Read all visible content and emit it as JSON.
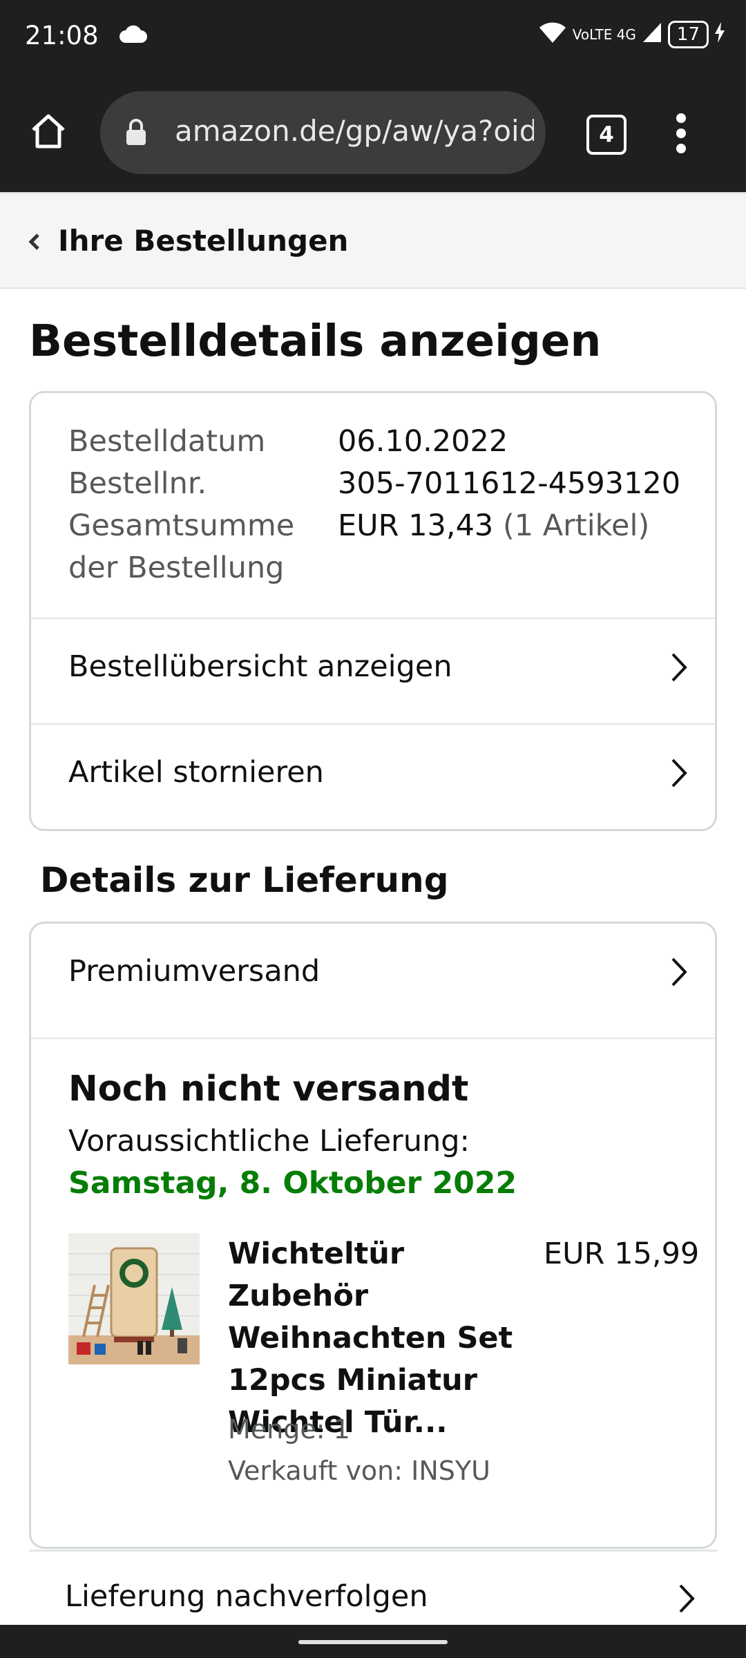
{
  "status_bar": {
    "time": "21:08",
    "network": "VoLTE 4G",
    "battery": "17"
  },
  "browser": {
    "url": "amazon.de/gp/aw/ya?oid=",
    "tab_count": "4"
  },
  "breadcrumb": {
    "back_label": "Ihre Bestellungen"
  },
  "page": {
    "title": "Bestelldetails anzeigen"
  },
  "order": {
    "date_label": "Bestelldatum",
    "date": "06.10.2022",
    "number_label": "Bestellnr.",
    "number": "305-7011612-4593120",
    "total_label_1": "Gesamtsumme",
    "total_label_2": "der Bestellung",
    "total": "EUR 13,43",
    "item_count": "(1 Artikel)",
    "actions": [
      "Bestellübersicht anzeigen",
      "Artikel stornieren"
    ]
  },
  "delivery": {
    "section_title": "Details zur Lieferung",
    "shipping_method": "Premiumversand",
    "status": "Noch nicht versandt",
    "eta_label": "Voraussichtliche Lieferung:",
    "eta_date": "Samstag, 8. Oktober 2022",
    "item": {
      "title": "Wichteltür Zubehör Weihnachten Set 12pcs Miniatur Wichtel Tür...",
      "price": "EUR 15,99",
      "quantity": "Menge: 1",
      "seller": "Verkauft von: INSYU"
    },
    "track_label": "Lieferung nachverfolgen"
  },
  "colors": {
    "delivery_green": "#067d06",
    "chrome_dark": "#1f1f1f"
  }
}
